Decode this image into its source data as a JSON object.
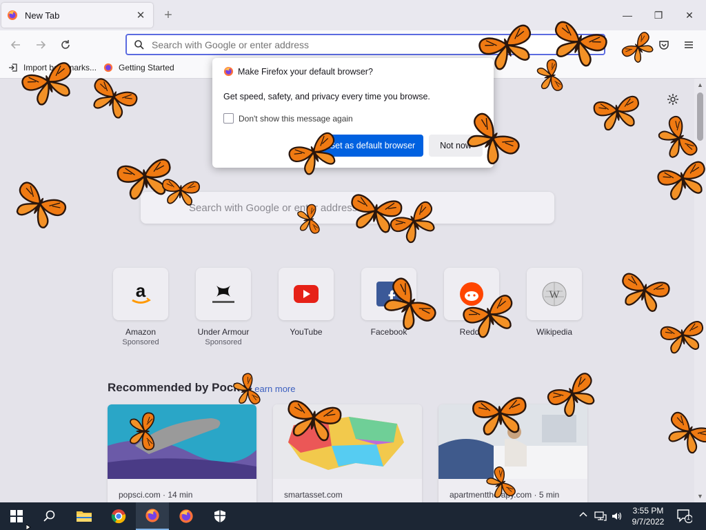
{
  "browser": {
    "tab": {
      "title": "New Tab",
      "close": "✕"
    },
    "new_tab": "+",
    "window_controls": {
      "minimize": "—",
      "restore": "❐",
      "close": "✕"
    },
    "url_placeholder": "Search with Google or enter address",
    "bookmarks": [
      {
        "label": "Import bookmarks..."
      },
      {
        "label": "Getting Started"
      }
    ]
  },
  "newtab": {
    "search_placeholder": "Search with Google or enter address",
    "top_sites": [
      {
        "name": "Amazon",
        "sponsored": "Sponsored",
        "icon": "amazon-icon"
      },
      {
        "name": "Under Armour",
        "sponsored": "Sponsored",
        "icon": "under-armour-icon"
      },
      {
        "name": "YouTube",
        "sponsored": "",
        "icon": "youtube-icon"
      },
      {
        "name": "Facebook",
        "sponsored": "",
        "icon": "facebook-icon"
      },
      {
        "name": "Reddit",
        "sponsored": "",
        "icon": "reddit-icon"
      },
      {
        "name": "Wikipedia",
        "sponsored": "",
        "icon": "wikipedia-icon"
      }
    ],
    "recommended": {
      "title": "Recommended by Pocket",
      "learn_more": "Learn more",
      "cards": [
        {
          "source": "popsci.com · 14 min"
        },
        {
          "source": "smartasset.com"
        },
        {
          "source": "apartmenttherapy.com · 5 min"
        }
      ]
    }
  },
  "dialog": {
    "title": "Make Firefox your default browser?",
    "body": "Get speed, safety, and privacy every time you browse.",
    "checkbox_label": "Don't show this message again",
    "primary_button": "Set as default browser",
    "secondary_button": "Not now"
  },
  "taskbar": {
    "time": "3:55 PM",
    "date": "9/7/2022",
    "notification_count": "1"
  },
  "colors": {
    "accent": "#0061e0",
    "urlbar_focus": "#5b6be0",
    "taskbar": "#1c2634",
    "content_bg": "#e4e3ea"
  }
}
